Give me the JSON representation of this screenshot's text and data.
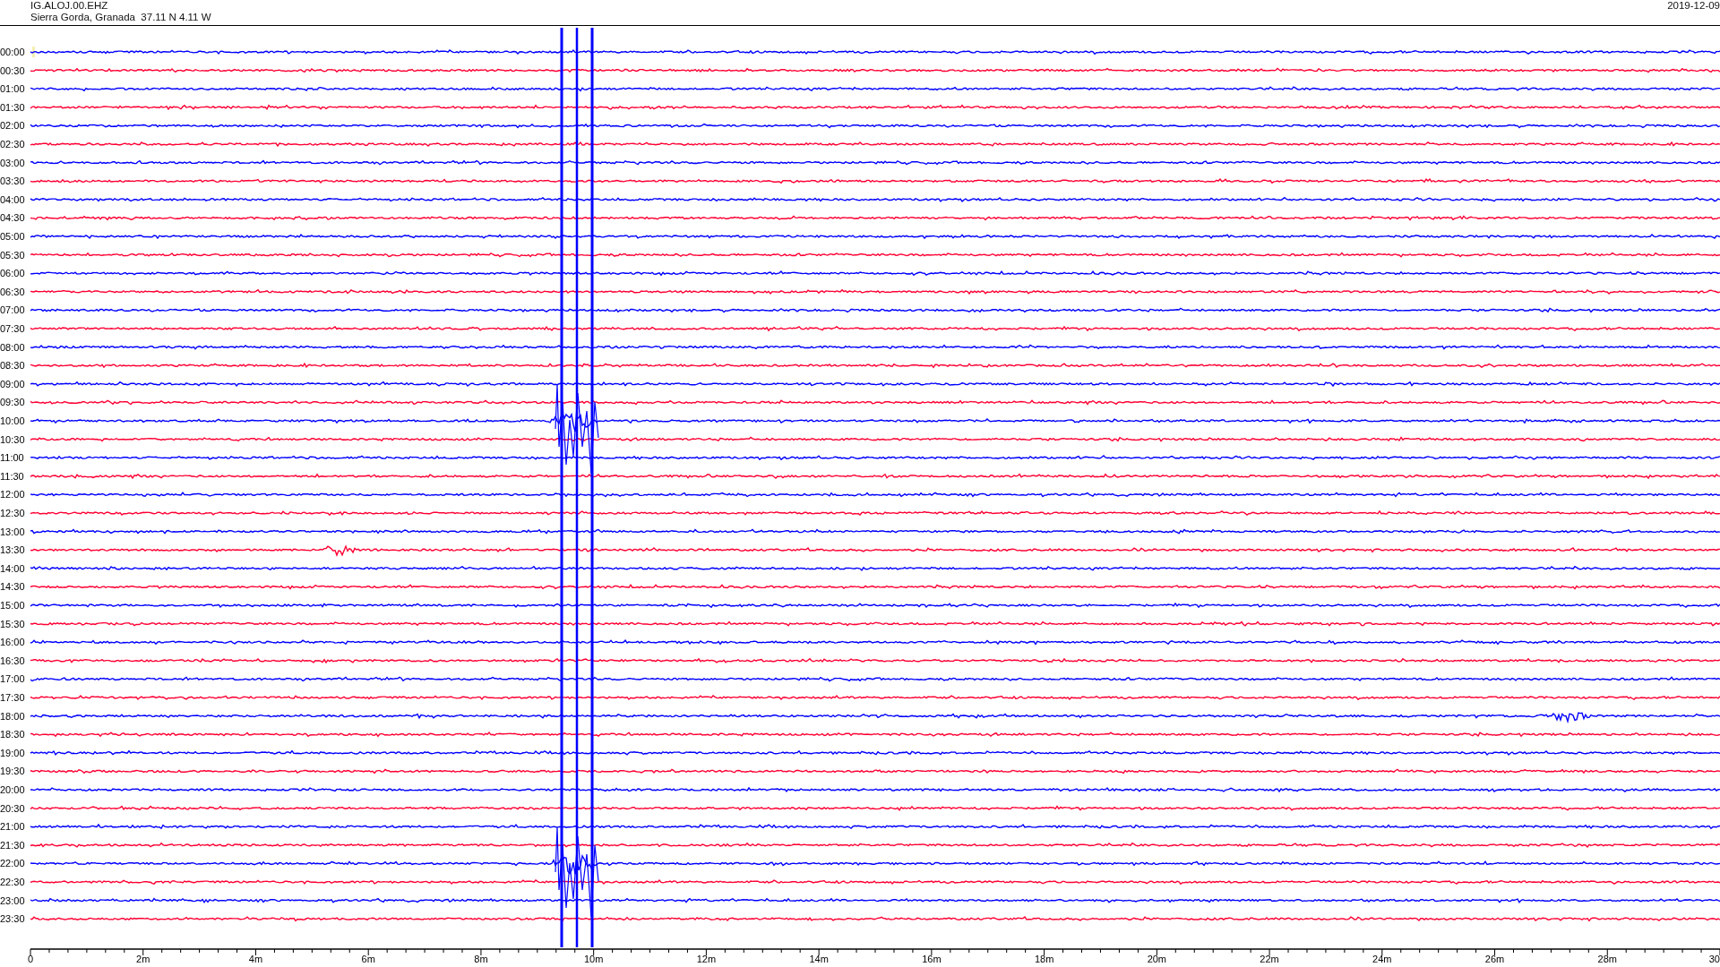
{
  "header": {
    "station": "IG.ALOJ.00.EHZ",
    "location": "Sierra Gorda, Granada  37.11 N 4.11 W",
    "date": "2019-12-09"
  },
  "traces": [
    {
      "time": "00:00",
      "color": "#0000ff"
    },
    {
      "time": "00:30",
      "color": "#ff0033"
    },
    {
      "time": "01:00",
      "color": "#0000ff"
    },
    {
      "time": "01:30",
      "color": "#ff0033"
    },
    {
      "time": "02:00",
      "color": "#0000ff"
    },
    {
      "time": "02:30",
      "color": "#ff0033"
    },
    {
      "time": "03:00",
      "color": "#0000ff"
    },
    {
      "time": "03:30",
      "color": "#ff0033"
    },
    {
      "time": "04:00",
      "color": "#0000ff"
    },
    {
      "time": "04:30",
      "color": "#ff0033"
    },
    {
      "time": "05:00",
      "color": "#0000ff"
    },
    {
      "time": "05:30",
      "color": "#ff0033"
    },
    {
      "time": "06:00",
      "color": "#0000ff"
    },
    {
      "time": "06:30",
      "color": "#ff0033"
    },
    {
      "time": "07:00",
      "color": "#0000ff"
    },
    {
      "time": "07:30",
      "color": "#ff0033"
    },
    {
      "time": "08:00",
      "color": "#0000ff"
    },
    {
      "time": "08:30",
      "color": "#ff0033"
    },
    {
      "time": "09:00",
      "color": "#0000ff"
    },
    {
      "time": "09:30",
      "color": "#ff0033"
    },
    {
      "time": "10:00",
      "color": "#0000ff"
    },
    {
      "time": "10:30",
      "color": "#ff0033"
    },
    {
      "time": "11:00",
      "color": "#0000ff"
    },
    {
      "time": "11:30",
      "color": "#ff0033"
    },
    {
      "time": "12:00",
      "color": "#0000ff"
    },
    {
      "time": "12:30",
      "color": "#ff0033"
    },
    {
      "time": "13:00",
      "color": "#0000ff"
    },
    {
      "time": "13:30",
      "color": "#ff0033"
    },
    {
      "time": "14:00",
      "color": "#0000ff"
    },
    {
      "time": "14:30",
      "color": "#ff0033"
    },
    {
      "time": "15:00",
      "color": "#0000ff"
    },
    {
      "time": "15:30",
      "color": "#ff0033"
    },
    {
      "time": "16:00",
      "color": "#0000ff"
    },
    {
      "time": "16:30",
      "color": "#ff0033"
    },
    {
      "time": "17:00",
      "color": "#0000ff"
    },
    {
      "time": "17:30",
      "color": "#ff0033"
    },
    {
      "time": "18:00",
      "color": "#0000ff"
    },
    {
      "time": "18:30",
      "color": "#ff0033"
    },
    {
      "time": "19:00",
      "color": "#0000ff"
    },
    {
      "time": "19:30",
      "color": "#ff0033"
    },
    {
      "time": "20:00",
      "color": "#0000ff"
    },
    {
      "time": "20:30",
      "color": "#ff0033"
    },
    {
      "time": "21:00",
      "color": "#0000ff"
    },
    {
      "time": "21:30",
      "color": "#ff0033"
    },
    {
      "time": "22:00",
      "color": "#0000ff"
    },
    {
      "time": "22:30",
      "color": "#ff0033"
    },
    {
      "time": "23:00",
      "color": "#0000ff"
    },
    {
      "time": "23:30",
      "color": "#ff0033"
    }
  ],
  "time_axis": {
    "labels": [
      "0",
      "2m",
      "4m",
      "6m",
      "8m",
      "10m",
      "12m",
      "14m",
      "16m",
      "18m",
      "20m",
      "22m",
      "24m",
      "26m",
      "28m",
      "30"
    ]
  }
}
